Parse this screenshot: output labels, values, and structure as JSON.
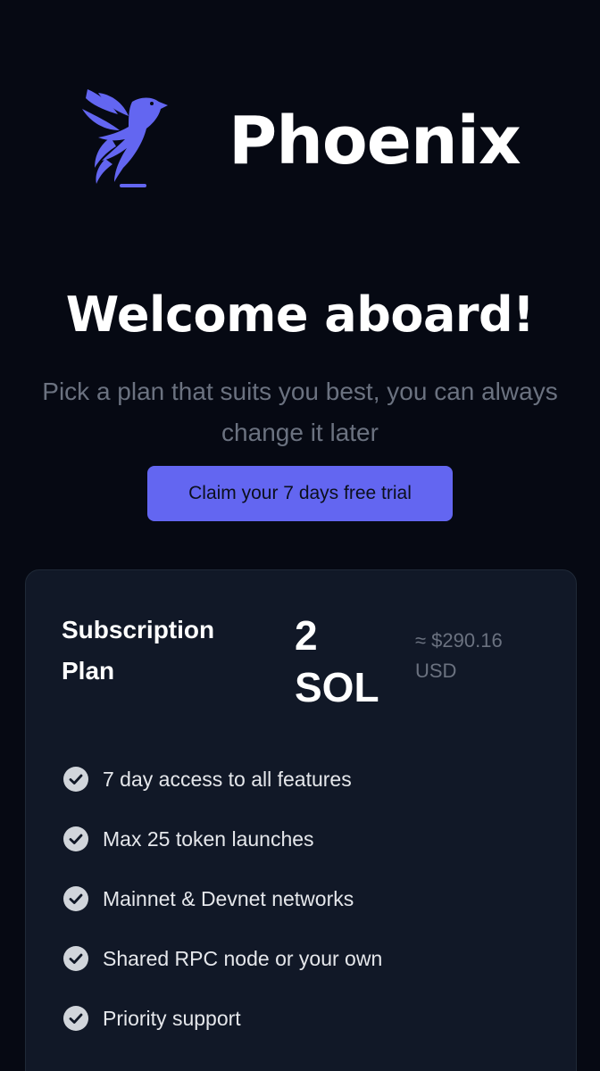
{
  "brand": {
    "name": "Phoenix",
    "logo_icon": "phoenix-bird-icon",
    "accent_color": "#6366f1"
  },
  "hero": {
    "headline": "Welcome aboard!",
    "subtitle": "Pick a plan that suits you best, you can always change it later",
    "cta_label": "Claim your 7 days free trial"
  },
  "plan": {
    "name": "Subscription Plan",
    "price_amount": "2",
    "price_unit": "SOL",
    "usd_equivalent": "≈ $290.16 USD",
    "features": [
      {
        "label": "7 day access to all features",
        "icon": "check-circle-icon"
      },
      {
        "label": "Max 25 token launches",
        "icon": "check-circle-icon"
      },
      {
        "label": "Mainnet & Devnet networks",
        "icon": "check-circle-icon"
      },
      {
        "label": "Shared RPC node or your own",
        "icon": "check-circle-icon"
      },
      {
        "label": "Priority support",
        "icon": "check-circle-icon"
      }
    ]
  }
}
